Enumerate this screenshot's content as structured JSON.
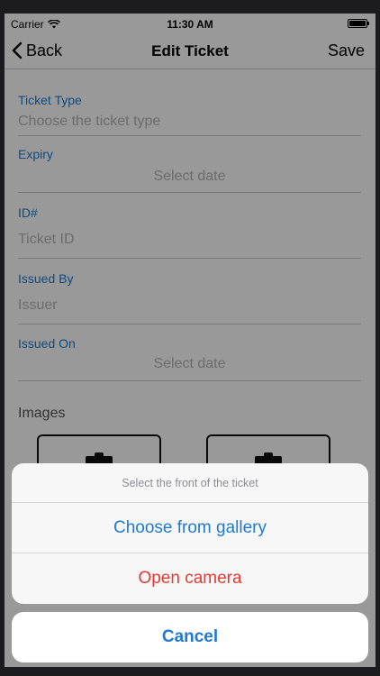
{
  "status_bar": {
    "carrier": "Carrier",
    "time": "11:30 AM"
  },
  "nav": {
    "back_label": "Back",
    "title": "Edit Ticket",
    "save_label": "Save"
  },
  "form": {
    "ticket_type": {
      "label": "Ticket Type",
      "placeholder": "Choose the ticket type"
    },
    "expiry": {
      "label": "Expiry",
      "placeholder": "Select date"
    },
    "id": {
      "label": "ID#",
      "placeholder": "Ticket ID"
    },
    "issued_by": {
      "label": "Issued By",
      "placeholder": "Issuer"
    },
    "issued_on": {
      "label": "Issued On",
      "placeholder": "Select date"
    },
    "images_label": "Images"
  },
  "action_sheet": {
    "title": "Select the front of the ticket",
    "options": [
      {
        "label": "Choose from gallery"
      },
      {
        "label": "Open camera"
      }
    ],
    "cancel_label": "Cancel"
  },
  "colors": {
    "accent": "#1f7bd1",
    "destructive": "#e53935",
    "placeholder": "#b5b5b8"
  }
}
